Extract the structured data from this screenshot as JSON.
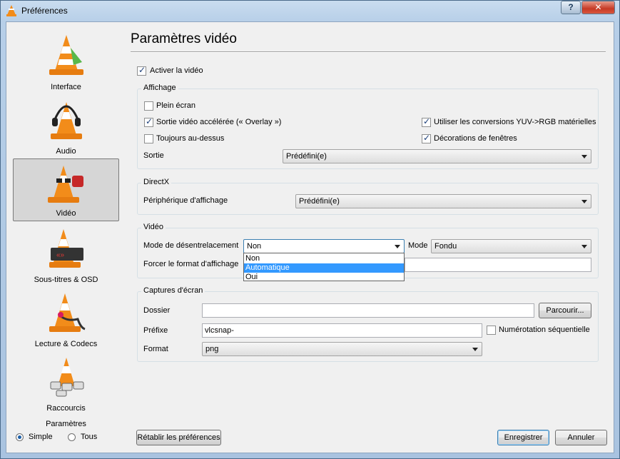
{
  "window": {
    "title": "Préférences",
    "help": "?",
    "close": "✕"
  },
  "sidebar": {
    "items": [
      {
        "label": "Interface",
        "icon": "interface-icon"
      },
      {
        "label": "Audio",
        "icon": "audio-icon"
      },
      {
        "label": "Vidéo",
        "icon": "video-icon",
        "selected": true
      },
      {
        "label": "Sous-titres & OSD",
        "icon": "subtitles-icon"
      },
      {
        "label": "Lecture & Codecs",
        "icon": "codecs-icon"
      },
      {
        "label": "Raccourcis",
        "icon": "hotkeys-icon"
      }
    ],
    "params_title": "Paramètres",
    "simple": "Simple",
    "all": "Tous",
    "mode_selected": "Simple"
  },
  "page": {
    "title": "Paramètres vidéo",
    "enable_video": {
      "label": "Activer la vidéo",
      "checked": true
    }
  },
  "display": {
    "legend": "Affichage",
    "fullscreen": {
      "label": "Plein écran",
      "checked": false
    },
    "overlay": {
      "label": "Sortie vidéo accélérée (« Overlay »)",
      "checked": true
    },
    "on_top": {
      "label": "Toujours au-dessus",
      "checked": false
    },
    "yuv": {
      "label": "Utiliser les conversions YUV->RGB matérielles",
      "checked": true
    },
    "decorations": {
      "label": "Décorations de fenêtres",
      "checked": true
    },
    "output_label": "Sortie",
    "output_value": "Prédéfini(e)"
  },
  "directx": {
    "legend": "DirectX",
    "device_label": "Périphérique d'affichage",
    "device_value": "Prédéfini(e)"
  },
  "video": {
    "legend": "Vidéo",
    "deinterlace_label": "Mode de désentrelacement",
    "deinterlace_value": "Non",
    "mode_label": "Mode",
    "mode_value": "Fondu",
    "force_label": "Forcer le format d'affichage",
    "force_value": "",
    "options": [
      "Non",
      "Automatique",
      "Oui"
    ],
    "highlighted": "Automatique"
  },
  "snapshots": {
    "legend": "Captures d'écran",
    "folder_label": "Dossier",
    "folder_value": "",
    "browse": "Parcourir...",
    "prefix_label": "Préfixe",
    "prefix_value": "vlcsnap-",
    "sequential": {
      "label": "Numérotation séquentielle",
      "checked": false
    },
    "format_label": "Format",
    "format_value": "png"
  },
  "footer": {
    "reset": "Rétablir les préférences",
    "save": "Enregistrer",
    "cancel": "Annuler"
  },
  "colors": {
    "accent": "#3399ff",
    "cone_orange": "#f28c1a"
  }
}
